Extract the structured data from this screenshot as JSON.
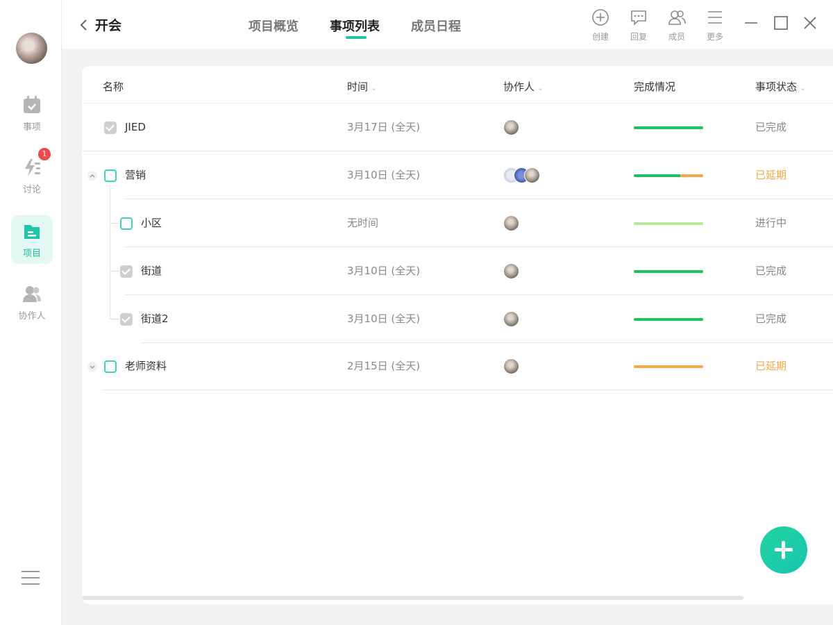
{
  "sidebar": {
    "items": [
      {
        "label": "事项",
        "icon": "calendar-check-icon"
      },
      {
        "label": "讨论",
        "icon": "lightning-icon",
        "badge": "1"
      },
      {
        "label": "项目",
        "icon": "folder-icon",
        "active": true
      },
      {
        "label": "协作人",
        "icon": "people-icon"
      }
    ],
    "menu_icon": "hamburger-menu-icon"
  },
  "header": {
    "title": "开会",
    "tabs": [
      {
        "label": "项目概览"
      },
      {
        "label": "事项列表",
        "active": true
      },
      {
        "label": "成员日程"
      }
    ],
    "tools": [
      {
        "label": "创建",
        "icon": "plus-circle-icon"
      },
      {
        "label": "回复",
        "icon": "chat-bubble-icon"
      },
      {
        "label": "成员",
        "icon": "members-icon"
      },
      {
        "label": "更多",
        "icon": "more-lines-icon"
      }
    ]
  },
  "table": {
    "columns": [
      "名称",
      "时间",
      "协作人",
      "完成情况",
      "事项状态"
    ],
    "rows": [
      {
        "name": "JIED",
        "time": "3月17日 (全天)",
        "status": "已完成",
        "progress": 1.0,
        "checked": true
      },
      {
        "name": "营销",
        "time": "3月10日 (全天)",
        "status": "已延期",
        "progress": 0.67,
        "checked": false,
        "expanded": true
      },
      {
        "name": "小区",
        "time": "无时间",
        "status": "进行中",
        "progress": 1.0,
        "checked": false
      },
      {
        "name": "街道",
        "time": "3月10日 (全天)",
        "status": "已完成",
        "progress": 1.0,
        "checked": true
      },
      {
        "name": "街道2",
        "time": "3月10日 (全天)",
        "status": "已完成",
        "progress": 1.0,
        "checked": true
      },
      {
        "name": "老师资料",
        "time": "2月15日 (全天)",
        "status": "已延期",
        "progress": 0.0,
        "checked": false,
        "expanded": false
      }
    ]
  },
  "colors": {
    "accent": "#1fc5a6",
    "progress_done": "#1cc35e",
    "progress_late": "#f7a743",
    "progress_doing": "#b8e69a",
    "status_late": "#f5a544"
  }
}
